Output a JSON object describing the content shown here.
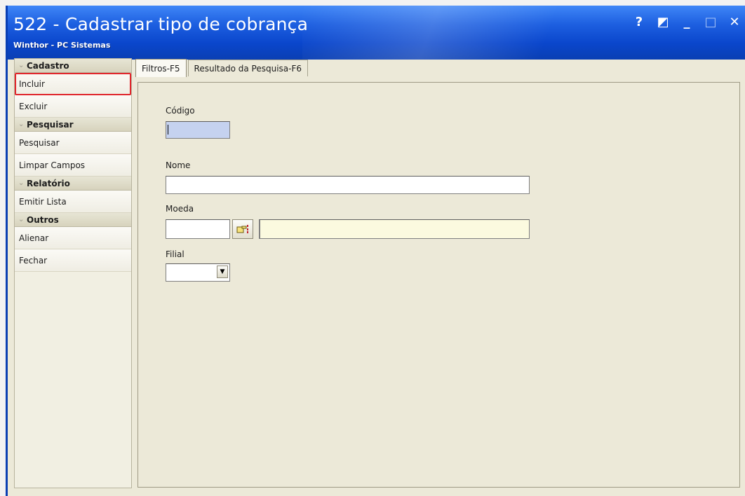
{
  "window": {
    "title": "522 - Cadastrar tipo de cobrança",
    "subtitle": "Winthor - PC Sistemas",
    "controls": {
      "help": "?",
      "restore": "◩",
      "minimize": "_",
      "maximize": "□",
      "close": "✕"
    }
  },
  "sidebar": {
    "groups": [
      {
        "title": "Cadastro",
        "items": [
          {
            "label": "Incluir",
            "selected": true
          },
          {
            "label": "Excluir"
          }
        ]
      },
      {
        "title": "Pesquisar",
        "items": [
          {
            "label": "Pesquisar"
          },
          {
            "label": "Limpar Campos"
          }
        ]
      },
      {
        "title": "Relatório",
        "items": [
          {
            "label": "Emitir Lista"
          }
        ]
      },
      {
        "title": "Outros",
        "items": [
          {
            "label": "Alienar"
          },
          {
            "label": "Fechar"
          }
        ]
      }
    ]
  },
  "tabs": [
    {
      "label": "Filtros-F5",
      "active": true
    },
    {
      "label": "Resultado da Pesquisa-F6",
      "active": false
    }
  ],
  "form": {
    "codigo": {
      "label": "Código",
      "value": ""
    },
    "nome": {
      "label": "Nome",
      "value": ""
    },
    "moeda": {
      "label": "Moeda",
      "code_value": "",
      "description_value": "",
      "lookup_icon": "hand-pointer-icon"
    },
    "filial": {
      "label": "Filial",
      "selected": ""
    }
  },
  "colors": {
    "titlebar": "#0a46cc",
    "selected_outline": "#e0262c",
    "focused_field": "#c5d2ef",
    "readonly_field": "#fbfadf"
  }
}
